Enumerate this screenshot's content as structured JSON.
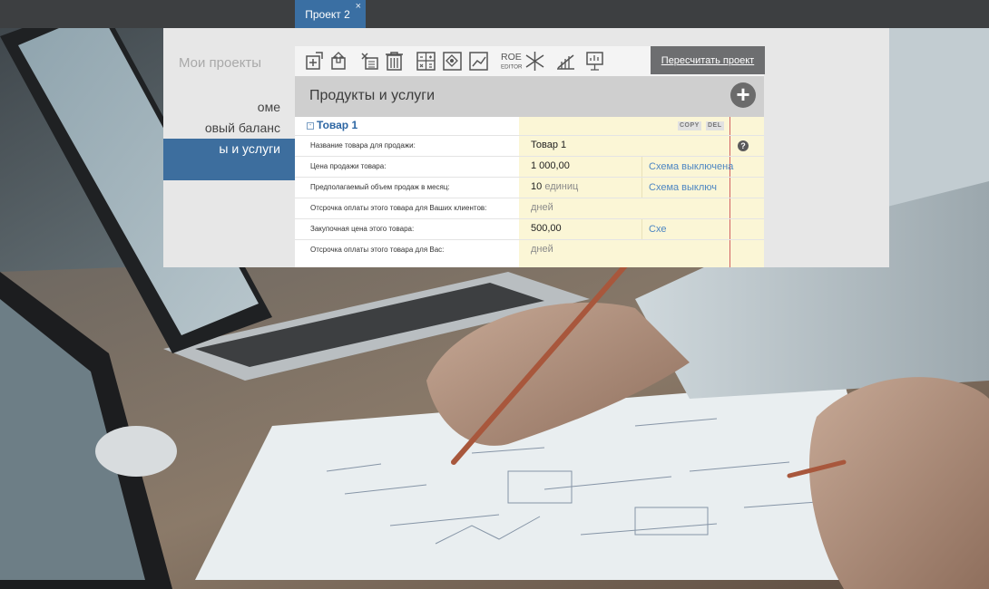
{
  "window": {
    "tab_label": "Проект 2",
    "tab_close": "×"
  },
  "sidebar": {
    "header": "Мои проекты",
    "items": [
      {
        "label": "оме"
      },
      {
        "label": "овый баланс"
      },
      {
        "label": "ы и услуги",
        "active": true
      },
      {
        "label": ""
      }
    ]
  },
  "toolbar": {
    "buttons": [
      "add-product-icon",
      "import-icon",
      "delete-list-icon",
      "trash-icon",
      "calculator-icon",
      "transfer-icon",
      "chart-icon",
      "roe-editor-icon",
      "scissors-icon",
      "growth-icon",
      "presentation-icon"
    ],
    "roe_label_top": "ROE",
    "roe_label_bottom": "EDITOR",
    "recalc_label": "Пересчитать проект"
  },
  "section": {
    "title": "Продукты и услуги",
    "add_symbol": "+"
  },
  "product": {
    "collapse_symbol": "-",
    "name": "Товар 1",
    "copy_label": "COPY",
    "del_label": "DEL",
    "help_symbol": "?",
    "rows": [
      {
        "label": "Название товара для продажи:",
        "value": "Товар 1",
        "unit": "",
        "scheme": ""
      },
      {
        "label": "Цена продажи товара:",
        "value": "1 000,00",
        "unit": "",
        "scheme": "Схема выключена"
      },
      {
        "label": "Предполагаемый объем продаж в месяц:",
        "value": "10",
        "unit": "единиц",
        "scheme": "Схема выключ"
      },
      {
        "label": "Отсрочка оплаты этого товара для Ваших клиентов:",
        "value": "",
        "unit": "дней",
        "scheme": ""
      },
      {
        "label": "Закупочная цена этого товара:",
        "value": "500,00",
        "unit": "",
        "scheme": "Схе"
      },
      {
        "label": "Отсрочка оплаты этого товара для Вас:",
        "value": "",
        "unit": "дней",
        "scheme": ""
      }
    ]
  },
  "colors": {
    "accent": "#3d6e9e",
    "tab": "#3a6fa3",
    "value_bg": "#fbf6d6",
    "link": "#4d86c2"
  }
}
